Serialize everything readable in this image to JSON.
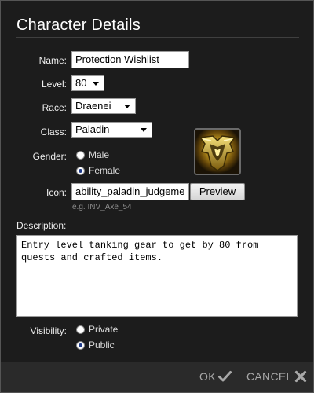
{
  "dialog": {
    "title": "Character Details"
  },
  "form": {
    "name": {
      "label": "Name:",
      "value": "Protection Wishlist"
    },
    "level": {
      "label": "Level:",
      "value": "80"
    },
    "race": {
      "label": "Race:",
      "value": "Draenei"
    },
    "class": {
      "label": "Class:",
      "value": "Paladin"
    },
    "gender": {
      "label": "Gender:",
      "options": [
        "Male",
        "Female"
      ],
      "selected": "Female"
    },
    "icon": {
      "label": "Icon:",
      "value": "ability_paladin_judgeme",
      "preview_label": "Preview",
      "hint": "e.g. INV_Axe_54",
      "image_icon": "paladin-judgement-icon"
    },
    "description": {
      "label": "Description:",
      "value": "Entry level tanking gear to get by 80 from\nquests and crafted items."
    },
    "visibility": {
      "label": "Visibility:",
      "options": [
        "Private",
        "Public"
      ],
      "selected": "Public"
    }
  },
  "footer": {
    "ok_label": "OK",
    "ok_icon": "check-icon",
    "cancel_label": "CANCEL",
    "cancel_icon": "close-icon"
  },
  "colors": {
    "background": "#1c1c1c",
    "footer": "#2a2a2a",
    "footer_text": "#a8a8a8",
    "radio_dot": "#1f3b8a"
  }
}
